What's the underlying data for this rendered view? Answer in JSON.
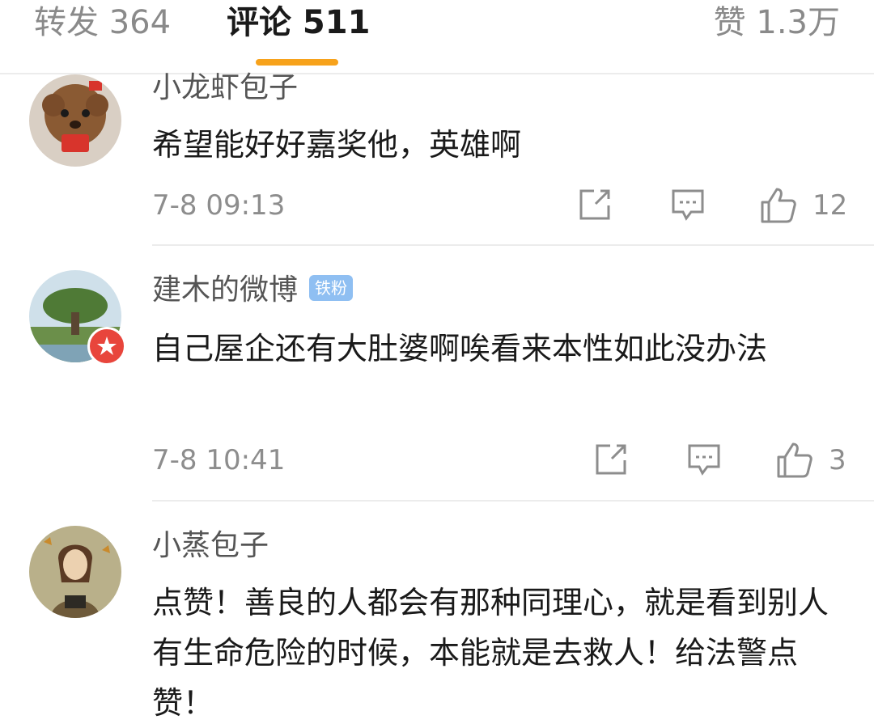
{
  "tabs": {
    "repost": "转发 364",
    "comments": "评论 511",
    "likes": "赞 1.3万"
  },
  "comments": [
    {
      "username": "小龙虾包子",
      "text": "希望能好好嘉奖他，英雄啊",
      "time": "7-8 09:13",
      "likes": "12"
    },
    {
      "username": "建木的微博",
      "badge": "铁粉",
      "text": "自己屋企还有大肚婆啊唉看来本性如此没办法",
      "time": "7-8 10:41",
      "likes": "3"
    },
    {
      "username": "小蒸包子",
      "text": "点赞！善良的人都会有那种同理心，就是看到别人有生命危险的时候，本能就是去救人！给法警点赞！"
    }
  ],
  "icons": {
    "repost": "share-icon",
    "reply": "comment-icon",
    "like": "thumbs-up-icon"
  },
  "colors": {
    "accent_underline": "#f7a21b",
    "fan_badge": "#8fbff2",
    "verified_badge": "#e8453c"
  }
}
